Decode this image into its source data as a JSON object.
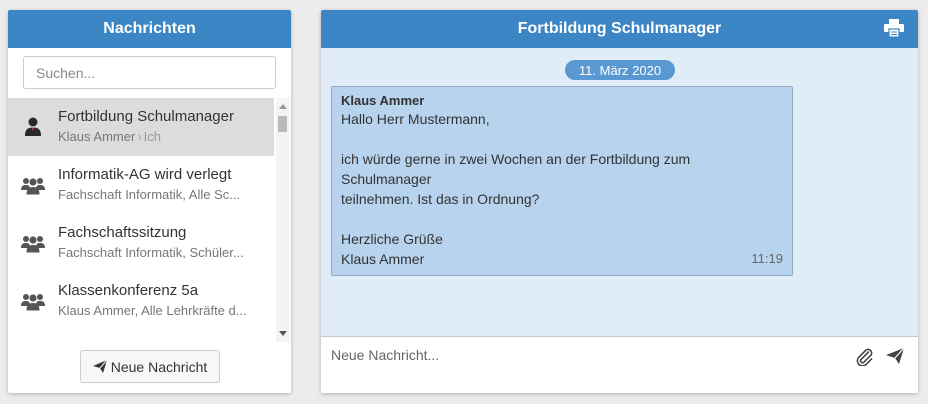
{
  "left": {
    "title": "Nachrichten",
    "search_placeholder": "Suchen...",
    "conversations": [
      {
        "title": "Fortbildung Schulmanager",
        "from": "Klaus Ammer",
        "arrow": "›",
        "to": "Ich",
        "icon": "user-icon",
        "active": true
      },
      {
        "title": "Informatik-AG wird verlegt",
        "subtitle": "Fachschaft Informatik, Alle Sc...",
        "icon": "group-icon"
      },
      {
        "title": "Fachschaftssitzung",
        "subtitle": "Fachschaft Informatik, Schüler...",
        "icon": "group-icon"
      },
      {
        "title": "Klassenkonferenz 5a",
        "subtitle": "Klaus Ammer, Alle Lehrkräfte d...",
        "icon": "group-icon"
      }
    ],
    "new_message_label": "Neue Nachricht"
  },
  "right": {
    "title": "Fortbildung Schulmanager",
    "print_icon": "printer-icon",
    "date": "11. März 2020",
    "message": {
      "sender": "Klaus Ammer",
      "lines": [
        "Hallo Herr Mustermann,",
        "",
        "ich würde gerne in zwei Wochen an der Fortbildung zum Schulmanager",
        "teilnehmen. Ist das in Ordnung?",
        "",
        "Herzliche Grüße",
        "Klaus Ammer"
      ],
      "time": "11:19"
    },
    "compose_placeholder": "Neue Nachricht...",
    "attach_icon": "paperclip-icon",
    "send_icon": "send-icon"
  },
  "colors": {
    "header": "#3d86c6",
    "chat_bg": "#e0ecf8",
    "bubble": "#b7d3ee",
    "date_pill": "#5a98d1",
    "active_item": "#dcdcdc"
  }
}
